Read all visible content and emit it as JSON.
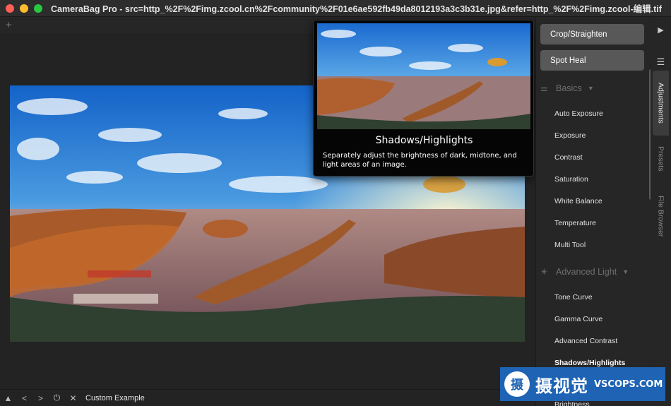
{
  "window": {
    "title": "CameraBag Pro - src=http_%2F%2Fimg.zcool.cn%2Fcommunity%2F01e6ae592fb49da8012193a3c3b31e.jpg&refer=http_%2F%2Fimg.zcool-编辑.tif"
  },
  "tabs": {
    "add_label": "+"
  },
  "tooltip": {
    "title": "Shadows/Highlights",
    "description": "Separately adjust the brightness of dark, midtone, and light areas of an image."
  },
  "panel": {
    "crop_button": "Crop/Straighten",
    "spot_heal_button": "Spot Heal",
    "sections": [
      {
        "title": "Basics",
        "icon": "sliders-icon",
        "items": [
          "Auto Exposure",
          "Exposure",
          "Contrast",
          "Saturation",
          "White Balance",
          "Temperature",
          "Multi Tool"
        ]
      },
      {
        "title": "Advanced Light",
        "icon": "sun-icon",
        "items": [
          "Tone Curve",
          "Gamma Curve",
          "Advanced Contrast",
          "Shadows/Highlights",
          "Brightness"
        ]
      }
    ],
    "active_item": "Shadows/Highlights"
  },
  "side_tabs": [
    "Adjustments",
    "Presets",
    "File Browser"
  ],
  "active_side_tab": "Adjustments",
  "bottom_bar": {
    "preset_name": "Custom Example"
  },
  "watermark": {
    "logo_glyph": "摄",
    "chinese": "摄视觉",
    "english": "VSCOPS.COM"
  },
  "colors": {
    "button_bg": "#585858",
    "panel_bg": "#262626",
    "watermark_bg": "#1e63b4"
  }
}
